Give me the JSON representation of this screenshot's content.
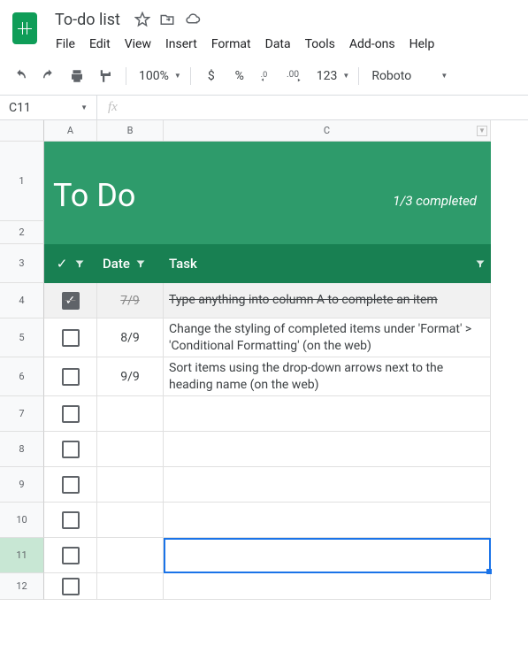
{
  "doc": {
    "title": "To-do list"
  },
  "menu": {
    "file": "File",
    "edit": "Edit",
    "view": "View",
    "insert": "Insert",
    "format": "Format",
    "data": "Data",
    "tools": "Tools",
    "addons": "Add-ons",
    "help": "Help"
  },
  "toolbar": {
    "zoom": "100%",
    "currency": "$",
    "percent": "%",
    "numfmt": "123",
    "font": "Roboto"
  },
  "cellref": "C11",
  "cols": {
    "a": "A",
    "b": "B",
    "c": "C"
  },
  "sheet": {
    "title": "To Do",
    "completed": "1/3 completed",
    "heading_check": "✓",
    "heading_date": "Date",
    "heading_task": "Task"
  },
  "rows": [
    {
      "n": "1"
    },
    {
      "n": "2"
    },
    {
      "n": "3"
    },
    {
      "n": "4",
      "checked": true,
      "date": "7/9",
      "task": "Type anything into column A to complete an item"
    },
    {
      "n": "5",
      "checked": false,
      "date": "8/9",
      "task": "Change the styling of completed items under 'Format' > 'Conditional Formatting' (on the web)"
    },
    {
      "n": "6",
      "checked": false,
      "date": "9/9",
      "task": "Sort items using the drop-down arrows next to the heading name (on the web)"
    },
    {
      "n": "7"
    },
    {
      "n": "8"
    },
    {
      "n": "9"
    },
    {
      "n": "10"
    },
    {
      "n": "11"
    },
    {
      "n": "12"
    }
  ]
}
